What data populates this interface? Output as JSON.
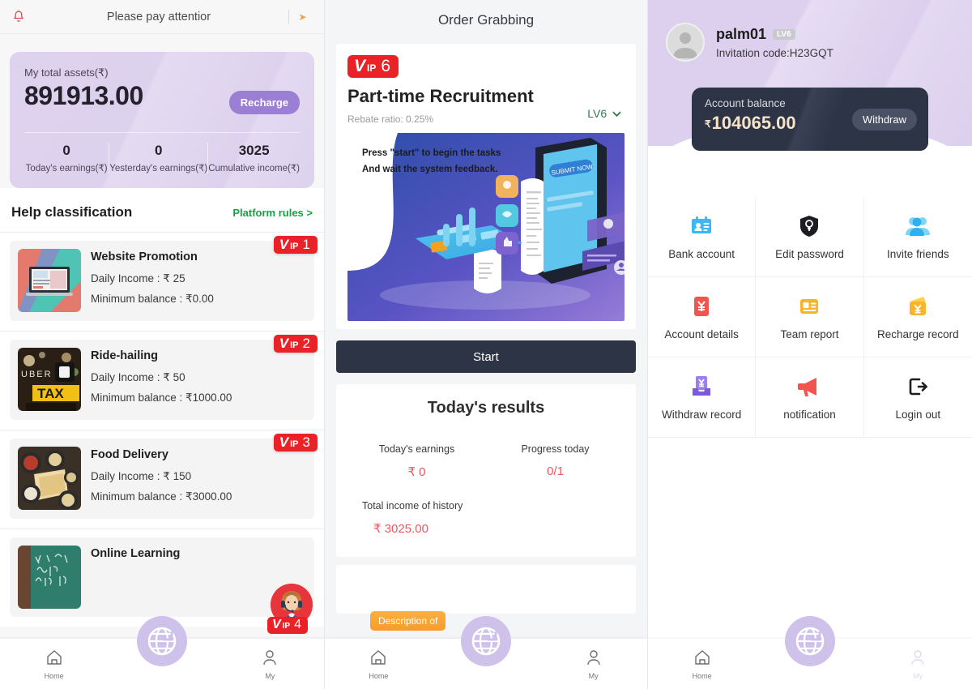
{
  "left": {
    "notice": {
      "icon": "bell-icon",
      "text": "Please pay attentior",
      "arrow": "➤"
    },
    "assets": {
      "label": "My total assets(₹)",
      "value": "891913.00",
      "recharge_label": "Recharge",
      "stats": [
        {
          "num": "0",
          "cap": "Today's earnings(₹)"
        },
        {
          "num": "0",
          "cap": "Yesterday's earnings(₹)"
        },
        {
          "num": "3025",
          "cap": "Cumulative income(₹)"
        }
      ]
    },
    "help": {
      "title": "Help classification",
      "rules_label": "Platform rules >"
    },
    "jobs": [
      {
        "name": "Website Promotion",
        "income": "Daily Income : ₹ 25",
        "minimum": "Minimum balance : ₹0.00",
        "vip": "1",
        "thumb": "laptop-promo-thumb"
      },
      {
        "name": "Ride-hailing",
        "income": "Daily Income : ₹ 50",
        "minimum": "Minimum balance : ₹1000.00",
        "vip": "2",
        "thumb": "taxi-thumb"
      },
      {
        "name": "Food Delivery",
        "income": "Daily Income : ₹ 150",
        "minimum": "Minimum balance : ₹3000.00",
        "vip": "3",
        "thumb": "food-thumb"
      },
      {
        "name": "Online Learning",
        "income": "",
        "minimum": "",
        "vip": "4",
        "thumb": "blackboard-thumb"
      }
    ],
    "vip_prefix_v": "V",
    "vip_prefix_ip": "IP",
    "customer_service": {
      "name": "customer-service-avatar",
      "vip": "4"
    },
    "nav": [
      {
        "label": "Home",
        "icon": "home-icon",
        "active": true
      },
      {
        "label": "My",
        "icon": "user-icon",
        "active": false
      }
    ],
    "nav_center_icon": "globe-icon"
  },
  "middle": {
    "header_title": "Order Grabbing",
    "task": {
      "vip_v": "V",
      "vip_ip": "IP",
      "vip_num": "6",
      "level_label": "LV6",
      "level_caret": "⌄",
      "title": "Part-time Recruitment",
      "rebate": "Rebate ratio: 0.25%",
      "hero_line1": "Press \"start\" to begin the tasks",
      "hero_line2": "And wait the system feedback.",
      "hero_phone_label": "SUBMIT NOW"
    },
    "start_label": "Start",
    "results": {
      "title": "Today's results",
      "cells": [
        {
          "cap": "Today's earnings",
          "val": "₹ 0"
        },
        {
          "cap": "Progress today",
          "val": "0/1"
        }
      ],
      "total_cap": "Total income of history",
      "total_val": "₹ 3025.00"
    },
    "description_chip": "Description of",
    "nav": [
      {
        "label": "Home",
        "icon": "home-icon",
        "active": true
      },
      {
        "label": "My",
        "icon": "user-icon",
        "active": false
      }
    ],
    "nav_center_icon": "globe-icon"
  },
  "right": {
    "profile": {
      "avatar": "default-user-avatar",
      "username": "palm01",
      "level": "LV6",
      "invitation": "Invitation code:H23GQT"
    },
    "balance": {
      "caption": "Account balance",
      "currency": "₹",
      "amount": "104065.00",
      "withdraw_label": "Withdraw"
    },
    "menu": [
      {
        "label": "Bank account",
        "icon": "bank-card-id-icon"
      },
      {
        "label": "Edit password",
        "icon": "shield-key-icon"
      },
      {
        "label": "Invite friends",
        "icon": "two-people-icon"
      },
      {
        "label": "Account details",
        "icon": "red-yen-note-icon"
      },
      {
        "label": "Team report",
        "icon": "yellow-report-icon"
      },
      {
        "label": "Recharge record",
        "icon": "yellow-wallet-yen-icon"
      },
      {
        "label": "Withdraw record",
        "icon": "purple-withdraw-icon"
      },
      {
        "label": "notification",
        "icon": "megaphone-icon"
      },
      {
        "label": "Login out",
        "icon": "logout-icon"
      }
    ],
    "nav": [
      {
        "label": "Home",
        "icon": "home-icon",
        "active": true
      },
      {
        "label": "My",
        "icon": "user-icon",
        "active": false
      }
    ],
    "nav_center_icon": "globe-icon"
  },
  "colors": {
    "vip_red": "#ea2127",
    "accent_purple": "#9b7fd4",
    "dark_navy": "#2d3446",
    "green_link": "#12a347",
    "pink_value": "#f0555f",
    "orange_chip": "#f79b2c"
  }
}
